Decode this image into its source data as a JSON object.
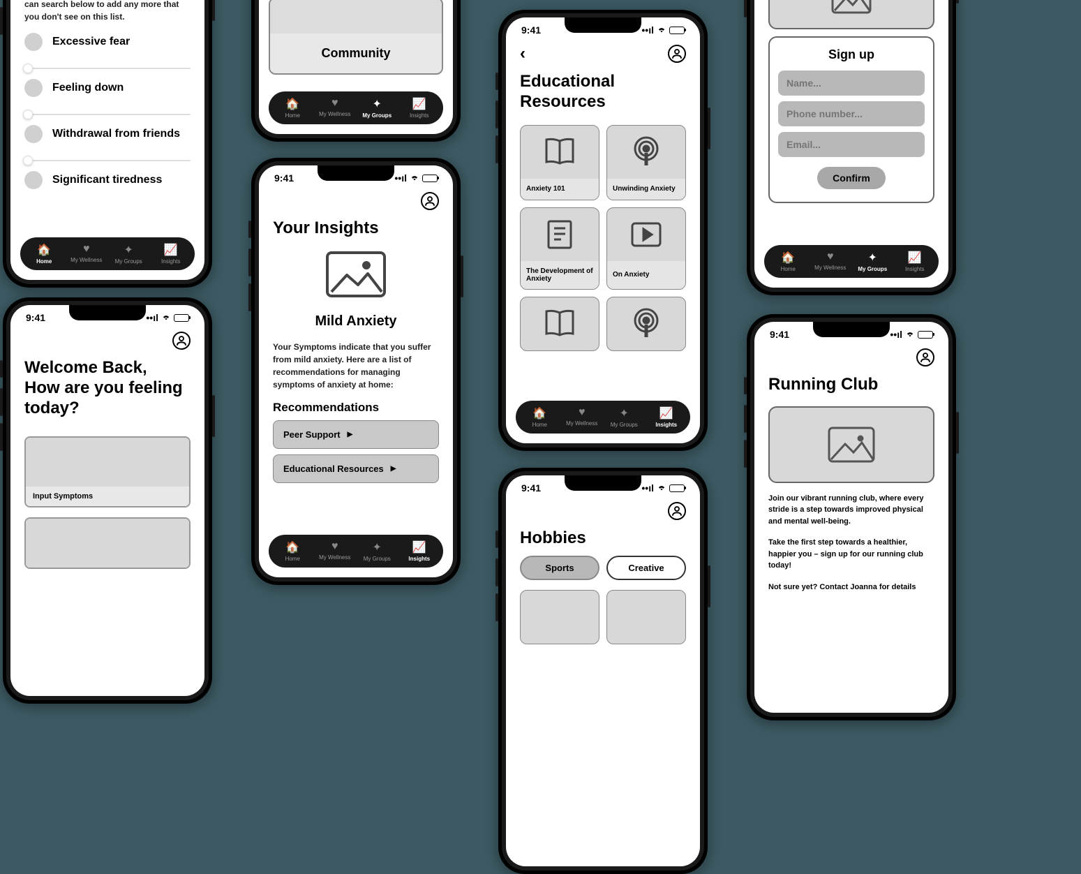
{
  "status_time": "9:41",
  "tabs": {
    "home": "Home",
    "wellness": "My Wellness",
    "groups": "My Groups",
    "insights": "Insights"
  },
  "p1": {
    "intro": "can search below to add any more that you don't see on this list.",
    "s1": "Excessive fear",
    "s2": "Feeling down",
    "s3": "Withdrawal from friends",
    "s4": "Significant tiredness"
  },
  "p2": {
    "l1": "Welcome Back,",
    "l2": "How are you feeling today?",
    "input_label": "Input Symptoms"
  },
  "p3": {
    "community": "Community"
  },
  "p4": {
    "title": "Your Insights",
    "diag": "Mild Anxiety",
    "desc": "Your Symptoms indicate that you suffer from mild anxiety. Here are a list of recommendations for managing symptoms of anxiety at home:",
    "rec_heading": "Recommendations",
    "r1": "Peer Support",
    "r2": "Educational Resources"
  },
  "p5": {
    "title": "Educational Resources",
    "c1": "Anxiety 101",
    "c2": "Unwinding Anxiety",
    "c3": "The Development of Anxiety",
    "c4": "On Anxiety"
  },
  "p6": {
    "title": "Hobbies",
    "t1": "Sports",
    "t2": "Creative"
  },
  "p7": {
    "title": "Sign up",
    "p_name": "Name...",
    "p_phone": "Phone number...",
    "p_email": "Email...",
    "confirm": "Confirm"
  },
  "p8": {
    "title": "Running Club",
    "b1": "Join our vibrant running club, where every stride is a step towards improved physical and mental well-being.",
    "b2": "Take the first step towards a healthier, happier you – sign up for our running club today!",
    "b3": "Not sure yet? Contact Joanna for details"
  }
}
